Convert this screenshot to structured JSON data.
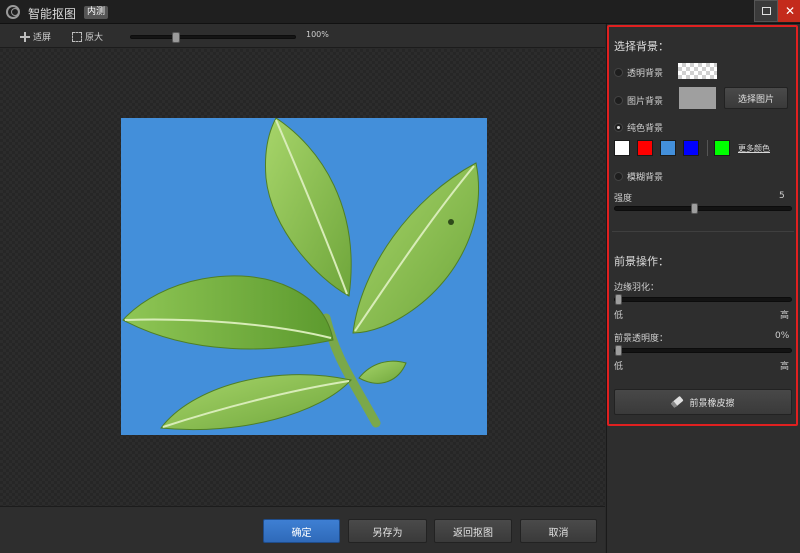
{
  "window": {
    "title": "智能抠图",
    "badge": "内测",
    "close_symbol": "✕"
  },
  "toolbar": {
    "fit_label": "适屏",
    "original_label": "原大",
    "zoom_value": "100%",
    "zoom_percent": 26
  },
  "preview": {
    "background_color": "#438fda",
    "subject": "leaf-branch"
  },
  "footer": {
    "ok_label": "确定",
    "save_as_label": "另存为",
    "back_label": "返回抠图",
    "cancel_label": "取消"
  },
  "background_panel": {
    "title": "选择背景：",
    "transparent_label": "透明背景",
    "image_label": "图片背景",
    "select_image_label": "选择图片",
    "solid_label": "纯色背景",
    "swatches": [
      "#ffffff",
      "#ff0000",
      "#438fda",
      "#0000ff",
      "#00ff00"
    ],
    "more_colors_label": "更多颜色",
    "blur_label": "模糊背景",
    "strength_label": "强度",
    "strength_value": "5",
    "strength_percent": 45,
    "selected": "solid"
  },
  "foreground_panel": {
    "title": "前景操作：",
    "feather_label": "边缘羽化：",
    "feather_low": "低",
    "feather_high": "高",
    "feather_percent": 0,
    "opacity_label": "前景透明度：",
    "opacity_value": "0%",
    "opacity_low": "低",
    "opacity_high": "高",
    "opacity_percent": 0,
    "eraser_label": "前景橡皮擦"
  },
  "icons": {
    "logo": "app-logo-icon",
    "fit": "fit-screen-icon",
    "original": "original-size-icon",
    "eraser": "eraser-icon",
    "restore": "restore-icon",
    "close": "close-icon"
  },
  "highlight_color": "#e02020"
}
